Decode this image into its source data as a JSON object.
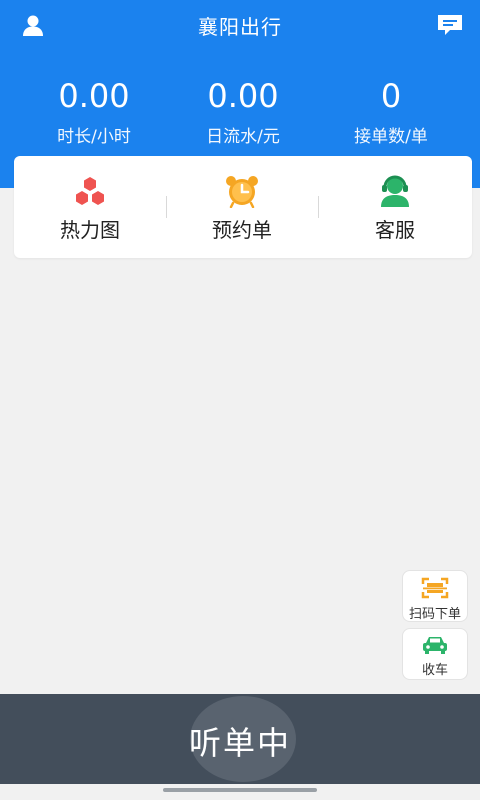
{
  "header": {
    "title": "襄阳出行",
    "left_icon": "user-icon",
    "right_icon": "message-icon"
  },
  "stats": [
    {
      "value": "0.00",
      "label": "时长/小时"
    },
    {
      "value": "0.00",
      "label": "日流水/元"
    },
    {
      "value": "0",
      "label": "接单数/单"
    }
  ],
  "actions": [
    {
      "label": "热力图",
      "icon": "heatmap-icon",
      "color": "#ef5350"
    },
    {
      "label": "预约单",
      "icon": "alarm-clock-icon",
      "color": "#f5a623"
    },
    {
      "label": "客服",
      "icon": "customer-service-icon",
      "color": "#2cb46a"
    }
  ],
  "side_buttons": {
    "scan": {
      "label": "扫码下单",
      "icon": "scan-icon",
      "color": "#f5a623"
    },
    "stop": {
      "label": "收车",
      "icon": "car-icon",
      "color": "#2cb46a"
    }
  },
  "bottom": {
    "listen_label": "听单中"
  },
  "colors": {
    "primary": "#1b82ee",
    "bottom_bar": "#434e5b",
    "background": "#f1f1f1"
  }
}
